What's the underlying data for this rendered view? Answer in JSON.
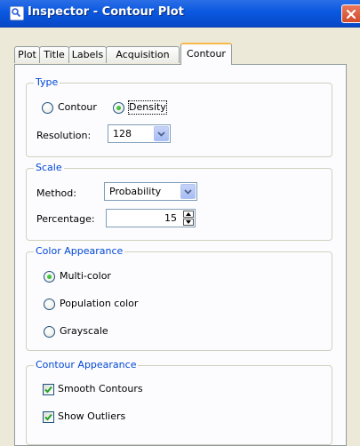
{
  "window": {
    "title": "Inspector - Contour Plot"
  },
  "tabs": [
    {
      "label": "Plot"
    },
    {
      "label": "Title"
    },
    {
      "label": "Labels"
    },
    {
      "label": "Acquisition"
    },
    {
      "label": "Contour",
      "active": true
    }
  ],
  "type_group": {
    "legend": "Type",
    "options": [
      {
        "label": "Contour",
        "selected": false
      },
      {
        "label": "Density",
        "selected": true
      }
    ],
    "resolution_label": "Resolution:",
    "resolution_value": "128"
  },
  "scale_group": {
    "legend": "Scale",
    "method_label": "Method:",
    "method_value": "Probability",
    "percentage_label": "Percentage:",
    "percentage_value": "15"
  },
  "color_group": {
    "legend": "Color Appearance",
    "options": [
      {
        "label": "Multi-color",
        "selected": true
      },
      {
        "label": "Population color",
        "selected": false
      },
      {
        "label": "Grayscale",
        "selected": false
      }
    ]
  },
  "contour_group": {
    "legend": "Contour Appearance",
    "checks": [
      {
        "label": "Smooth Contours",
        "checked": true
      },
      {
        "label": "Show Outliers",
        "checked": true
      }
    ]
  },
  "icons": {
    "app": "inspector-icon",
    "close": "close-icon",
    "dropdown": "chevron-down-icon",
    "spin_up": "arrow-up-icon",
    "spin_down": "arrow-down-icon",
    "check": "checkmark-icon"
  },
  "colors": {
    "titlebar": "#0a58e0",
    "legend_text": "#0046d5",
    "active_tab_accent": "#f9b948",
    "close_button": "#d24a2a"
  }
}
